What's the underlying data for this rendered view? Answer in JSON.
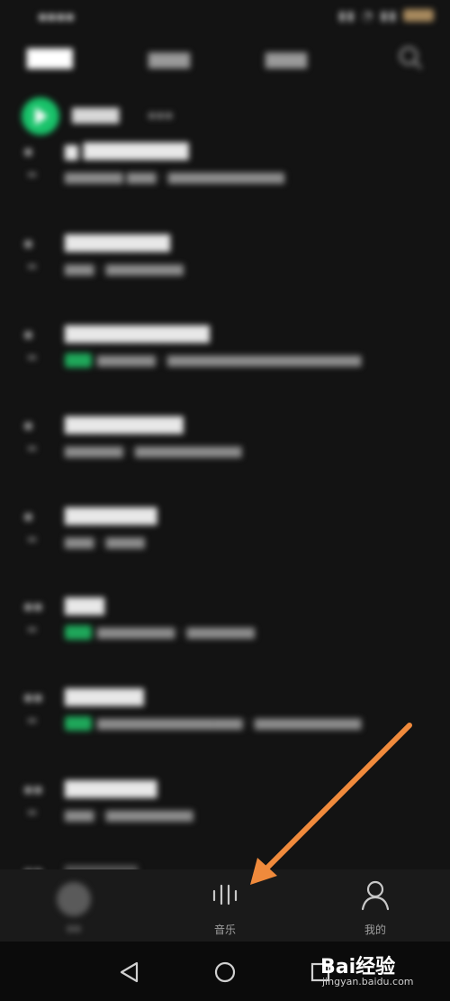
{
  "colors": {
    "background": "#131313",
    "accent": "#19c36a",
    "arrow": "#f08a3c"
  },
  "bottom_nav": {
    "items": [
      {
        "label": "",
        "icon": "avatar-blob-icon",
        "active": false
      },
      {
        "label": "音乐",
        "icon": "music-bars-icon",
        "active": true
      },
      {
        "label": "我的",
        "icon": "user-icon",
        "active": false
      }
    ]
  },
  "system_nav": {
    "icons": [
      "back-triangle-icon",
      "home-circle-icon",
      "recents-square-icon"
    ]
  },
  "watermark": {
    "main": "Bai经验",
    "sub": "jingyan.baidu.com"
  }
}
